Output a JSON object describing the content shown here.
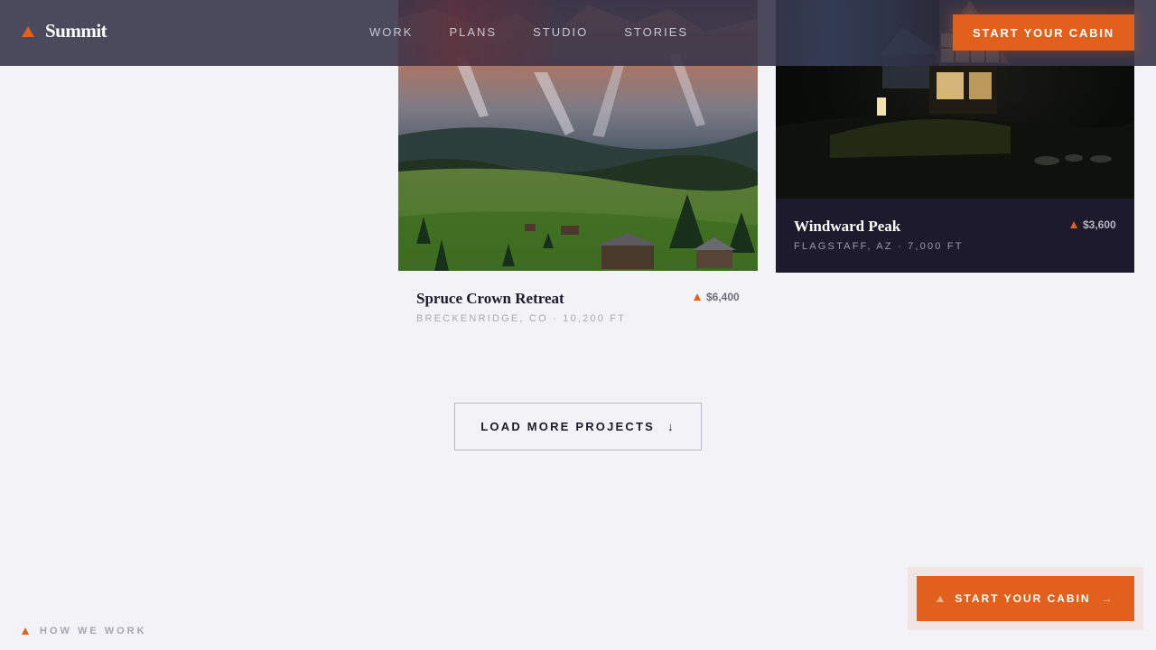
{
  "brand": {
    "name": "Summit",
    "accent": "#e2601d"
  },
  "nav": {
    "items": [
      {
        "label": "WORK"
      },
      {
        "label": "PLANS"
      },
      {
        "label": "STUDIO"
      },
      {
        "label": "STORIES"
      }
    ],
    "cta_label": "START YOUR CABIN"
  },
  "projects": [
    {
      "title": "Spruce Crown Retreat",
      "location": "BRECKENRIDGE, CO · 10,200 FT",
      "price": "$6,400",
      "image": "mountain-meadow-cabins"
    },
    {
      "title": "Windward Peak",
      "location": "FLAGSTAFF, AZ · 7,000 FT",
      "price": "$3,600",
      "image": "a-frame-cabin-night"
    }
  ],
  "load_more": {
    "label": "LOAD MORE PROJECTS",
    "icon": "↓"
  },
  "footer": {
    "how_we_work": "HOW WE WORK",
    "float_cta_label": "START YOUR CABIN",
    "float_cta_arrow": "→"
  }
}
